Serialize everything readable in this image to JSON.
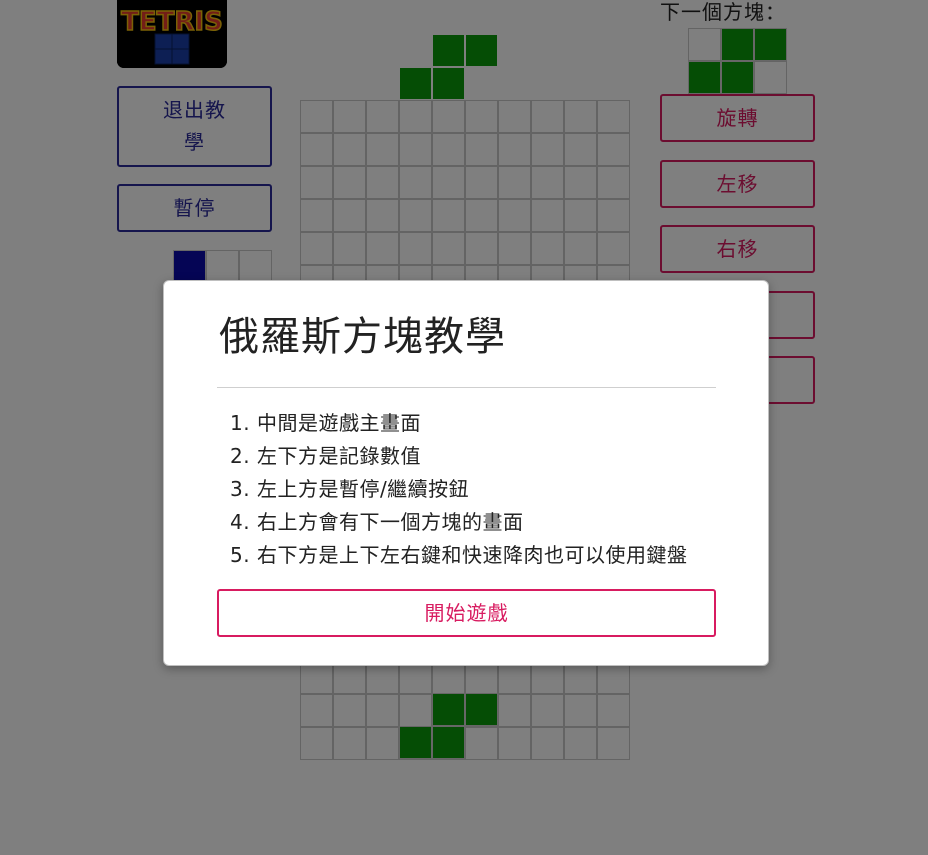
{
  "logo": {
    "text": "TETRIS"
  },
  "left_panel": {
    "exit_tutorial_label": "退出教學",
    "pause_label": "暫停"
  },
  "right_panel": {
    "next_piece_label": "下一個方塊：",
    "rotate_label": "旋轉",
    "move_left_label": "左移",
    "move_right_label": "右移"
  },
  "colors": {
    "piece_green": "#0a9b0a",
    "piece_blue": "#0a0aaa",
    "accent_pink": "#d81b60",
    "accent_navy": "#2a2a9a"
  },
  "board": {
    "columns": 10,
    "rows": 20,
    "falling_piece": {
      "shape": "S",
      "color": "green"
    }
  },
  "next_piece": {
    "shape": "S",
    "color": "green",
    "grid": [
      [
        0,
        1,
        1
      ],
      [
        1,
        1,
        0
      ]
    ]
  },
  "score_preview": {
    "first_cell_color": "blue"
  },
  "modal": {
    "title": "俄羅斯方塊教學",
    "instructions": [
      "1. 中間是遊戲主畫面",
      "2. 左下方是記錄數值",
      "3. 左上方是暫停/繼續按鈕",
      "4. 右上方會有下一個方塊的畫面",
      "5. 右下方是上下左右鍵和快速降肉也可以使用鍵盤"
    ],
    "start_label": "開始遊戲"
  }
}
